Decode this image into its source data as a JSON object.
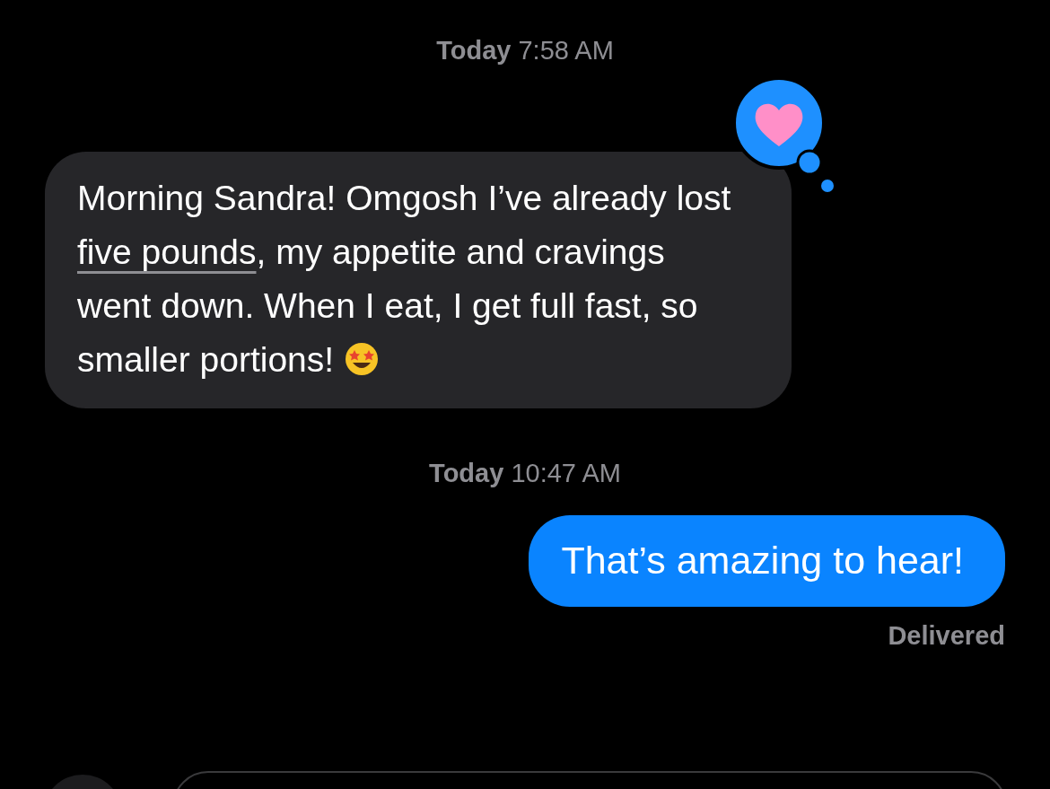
{
  "thread": [
    {
      "kind": "timestamp",
      "text": "**Today** 7:58 AM"
    },
    {
      "kind": "incoming",
      "segments": [
        {
          "kind": "text",
          "text": "Morning Sandra! Omgosh I’ve already lost "
        },
        {
          "kind": "detected",
          "text": "five pounds"
        },
        {
          "kind": "text",
          "text": ", my appetite and cravings went down. When I eat, I get full fast, so smaller portions! "
        },
        {
          "kind": "emoji"
        }
      ],
      "reaction": {
        "kind": "heart"
      }
    },
    {
      "kind": "timestamp",
      "text": "**Today** 10:47 AM"
    },
    {
      "kind": "outgoing",
      "segments": [
        {
          "kind": "text",
          "text": "That’s amazing to hear!"
        }
      ],
      "status": "Delivered"
    }
  ]
}
